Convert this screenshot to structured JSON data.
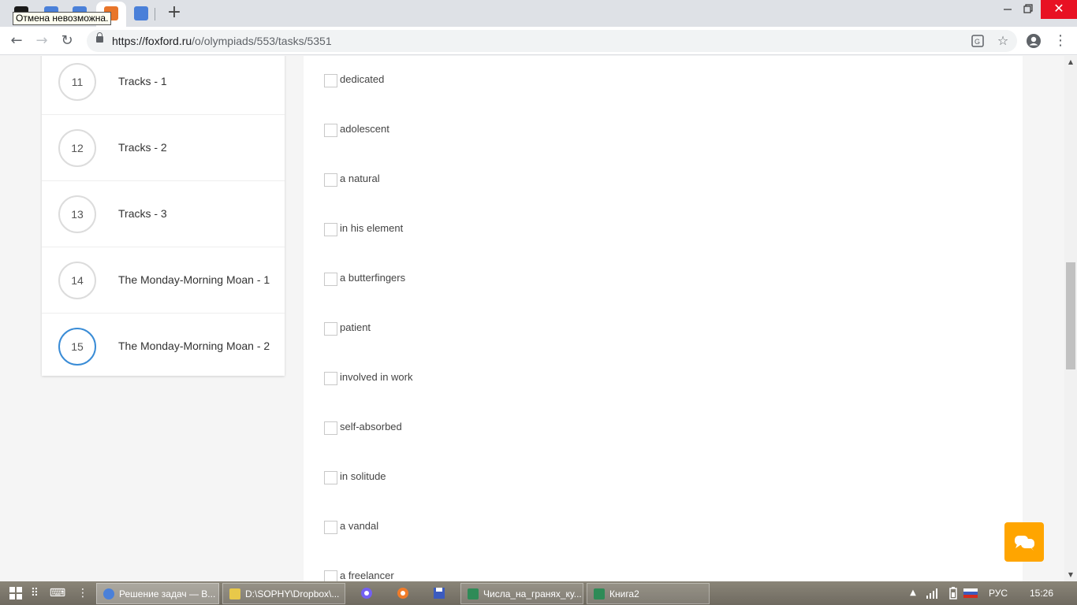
{
  "browser": {
    "tooltip": "Отмена невозможна.",
    "new_tab_icon": "plus-icon",
    "url_host": "https://foxford.ru",
    "url_path": "/o/olympiads/553/tasks/5351",
    "window_controls": [
      "minimize-icon",
      "restore-icon",
      "close-icon"
    ],
    "tab_colors": {
      "tab1": "#1a1a1a",
      "tab2": "#4a80d9",
      "tab3": "#4a80d9",
      "tab4": "#e8752a",
      "tab5": "#4a80d9"
    }
  },
  "sidebar": {
    "tasks": [
      {
        "number": "11",
        "title": "Tracks - 1",
        "active": false
      },
      {
        "number": "12",
        "title": "Tracks - 2",
        "active": false
      },
      {
        "number": "13",
        "title": "Tracks - 3",
        "active": false
      },
      {
        "number": "14",
        "title": "The Monday-Morning Moan - 1",
        "active": false
      },
      {
        "number": "15",
        "title": "The Monday-Morning Moan - 2",
        "active": true
      }
    ]
  },
  "content": {
    "options": [
      "dedicated",
      "adolescent",
      "a natural",
      "in his element",
      "a butterfingers",
      "patient",
      "involved in work",
      "self-absorbed",
      "in solitude",
      "a vandal",
      "a freelancer"
    ]
  },
  "chat_button": {
    "icon": "chat-bubbles-icon",
    "color": "#ffa500"
  },
  "taskbar": {
    "tasks": [
      {
        "label": "Решение задач — В...",
        "icon_color": "#4a80d9",
        "active": true
      },
      {
        "label": "D:\\SOPHY\\Dropbox\\...",
        "icon_color": "#e8c84a",
        "active": false
      },
      {
        "label": "Числа_на_гранях_ку...",
        "icon_color": "#2e8b57",
        "active": false
      },
      {
        "label": "Книга2",
        "icon_color": "#2e8b57",
        "active": false
      }
    ],
    "language": "РУС",
    "clock": "15:26"
  },
  "accent_color": "#3a8cd6"
}
